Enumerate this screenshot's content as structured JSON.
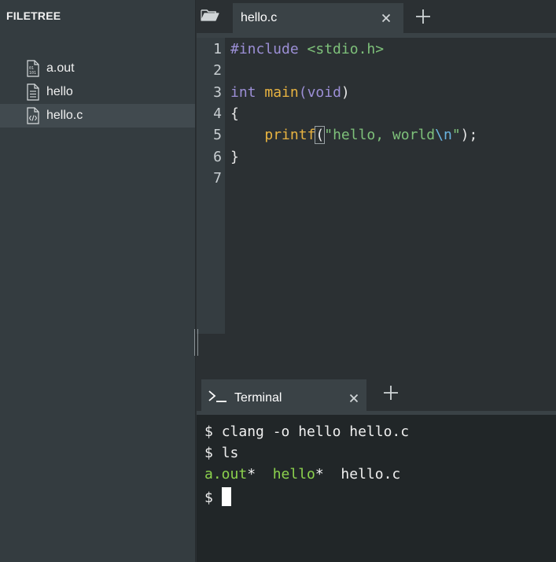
{
  "sidebar": {
    "title": "FILETREE",
    "files": [
      {
        "name": "a.out",
        "icon": "binary-file-icon"
      },
      {
        "name": "hello",
        "icon": "text-file-icon"
      },
      {
        "name": "hello.c",
        "icon": "code-file-icon",
        "active": true
      }
    ]
  },
  "editor": {
    "tab_label": "hello.c",
    "line_numbers": [
      "1",
      "2",
      "3",
      "4",
      "5",
      "6",
      "7"
    ],
    "code": {
      "l1_directive": "#include",
      "l1_header": "<stdio.h>",
      "l3_type": "int",
      "l3_func": "main",
      "l3_open": "(",
      "l3_param": "void",
      "l3_close": ")",
      "l4_brace": "{",
      "l5_indent": "    ",
      "l5_func": "printf",
      "l5_open": "(",
      "l5_str_a": "\"hello, world",
      "l5_escape": "\\n",
      "l5_str_b": "\"",
      "l5_close": ");",
      "l6_brace": "}"
    }
  },
  "terminal": {
    "tab_label": "Terminal",
    "prompt": "$",
    "lines": {
      "cmd1": "clang -o hello hello.c",
      "cmd2": "ls",
      "out_a": "a.out",
      "out_star1": "*  ",
      "out_b": "hello",
      "out_star2": "*  ",
      "out_c": "hello.c"
    }
  },
  "colors": {
    "sidebar_bg": "#343c40",
    "editor_bg": "#2b3033",
    "terminal_bg": "#212628",
    "keyword": "#9c8fd6",
    "function": "#e8b341",
    "string": "#7ec17a",
    "escape": "#6ab4e0",
    "executable": "#8cd24d"
  }
}
